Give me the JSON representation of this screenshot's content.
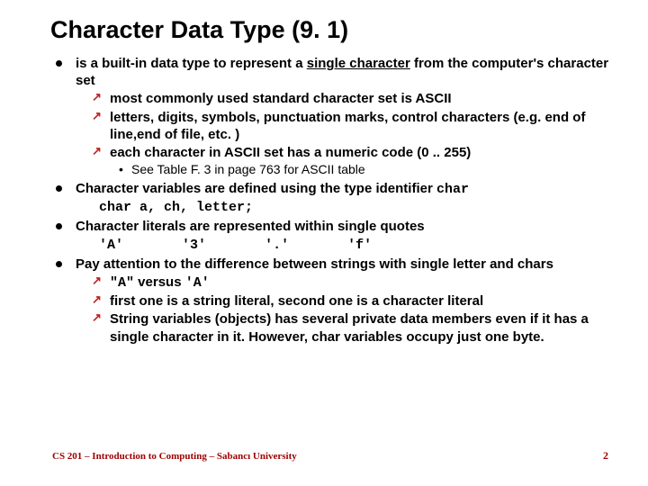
{
  "title": "Character Data Type (9. 1)",
  "bullets": [
    {
      "text_a": "is a built-in data type to represent a ",
      "text_u": "single character",
      "text_b": " from the computer's character set",
      "sub": [
        "most commonly used standard character set is ASCII",
        "letters, digits, symbols, punctuation marks, control characters (e.g. end of line,end of file, etc. )",
        "each character in ASCII set has a numeric code (0 .. 255)"
      ],
      "subsub": [
        "See Table F. 3 in page 763 for ASCII table"
      ]
    },
    {
      "text": "Character variables are defined using  the type identifier ",
      "tail_mono": "char",
      "code_line": "char a, ch, letter;"
    },
    {
      "text": "Character literals are represented within single quotes",
      "literals": [
        "'A'",
        "'3'",
        "'.'",
        "'f'"
      ]
    },
    {
      "text": "Pay attention to the difference between strings with single letter and chars",
      "sub2": [
        {
          "a": "\"A\"",
          "mid": " versus ",
          "b": "'A'"
        },
        "first one is a string literal, second one is a character literal",
        "String variables (objects) has several private data members even if it has a single character in it. However, char variables occupy just one byte."
      ]
    }
  ],
  "footer": {
    "left": "CS 201 – Introduction to Computing – Sabancı University",
    "page": "2"
  }
}
